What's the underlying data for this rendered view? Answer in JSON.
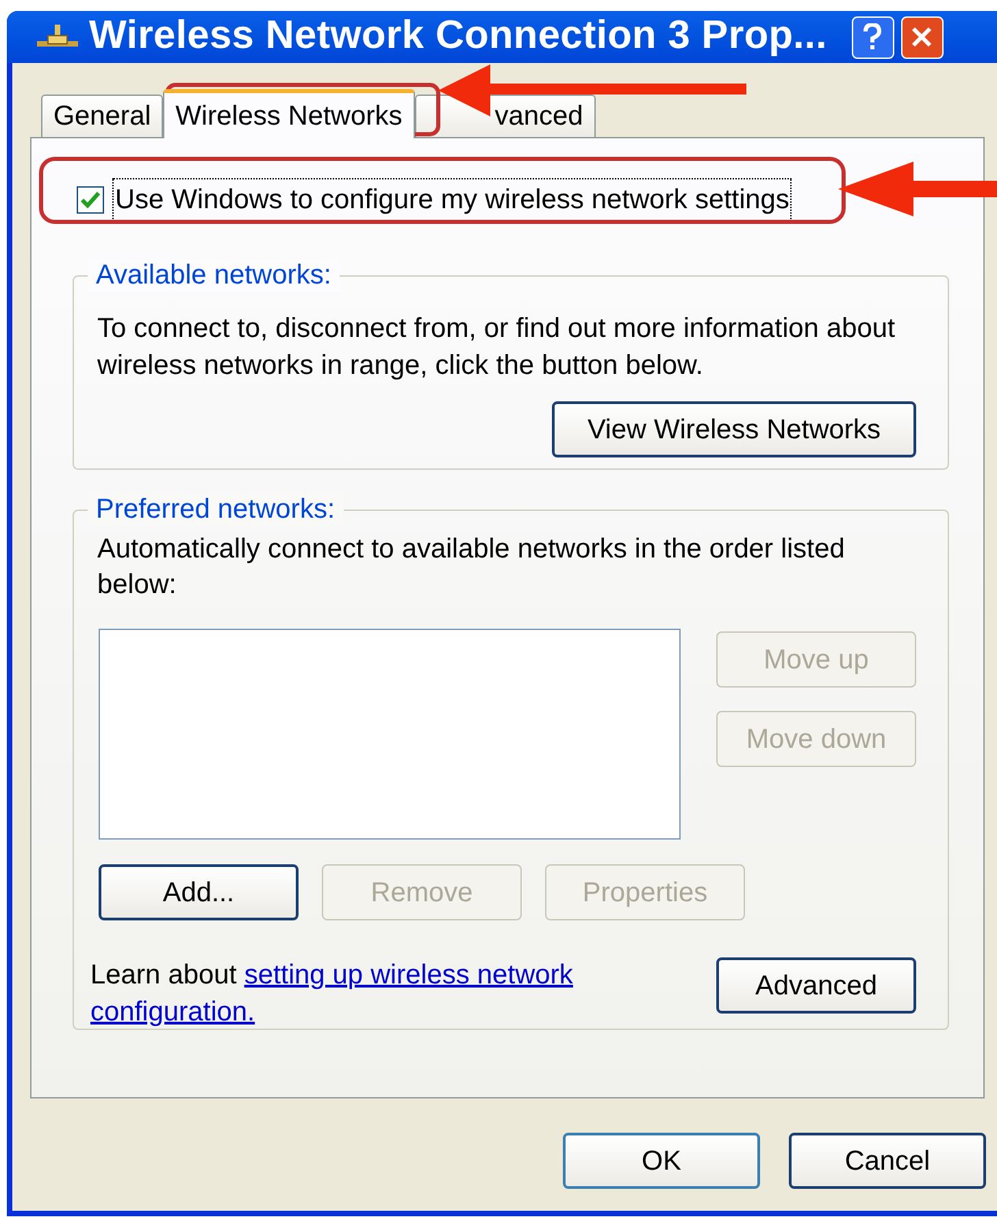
{
  "window": {
    "title": "Wireless Network Connection 3 Prop..."
  },
  "tabs": [
    {
      "label": "General",
      "selected": false
    },
    {
      "label": "Wireless Networks",
      "selected": true
    },
    {
      "label": "vanced",
      "selected": false
    }
  ],
  "use_windows_checkbox": {
    "label": "Use Windows to configure my wireless network settings",
    "checked": true
  },
  "available_networks": {
    "legend": "Available networks:",
    "description": "To connect to, disconnect from, or find out more information about wireless networks in range, click the button below.",
    "button": "View Wireless Networks"
  },
  "preferred_networks": {
    "legend": "Preferred networks:",
    "description": "Automatically connect to available networks in the order listed below:",
    "side_buttons": [
      {
        "label": "Move up",
        "disabled": true
      },
      {
        "label": "Move down",
        "disabled": true
      }
    ],
    "buttons": [
      {
        "label": "Add...",
        "disabled": false
      },
      {
        "label": "Remove",
        "disabled": true
      },
      {
        "label": "Properties",
        "disabled": true
      }
    ],
    "learn_text": "Learn about",
    "learn_link": "setting up wireless network configuration.",
    "advanced_button": "Advanced"
  },
  "buttons": [
    "OK",
    "Cancel"
  ]
}
